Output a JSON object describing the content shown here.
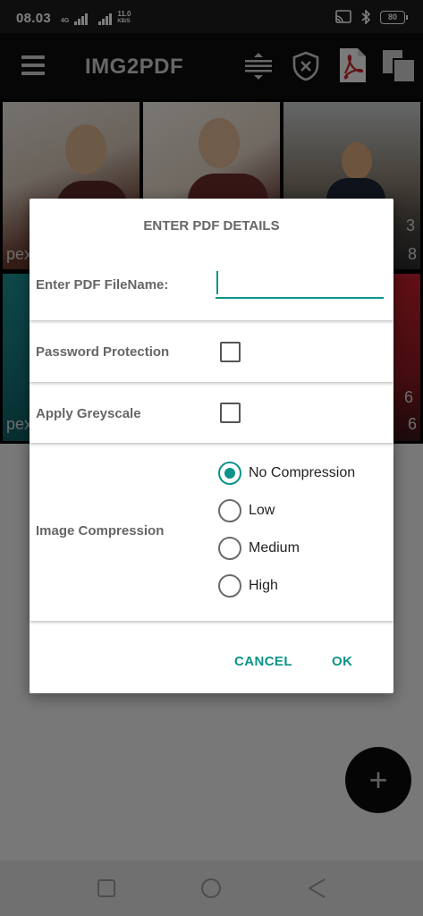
{
  "status_bar": {
    "time": "08.03",
    "network_type": "4G",
    "net_speed_value": "11.0",
    "net_speed_unit": "KB/S",
    "battery": "80"
  },
  "toolbar": {
    "title": "IMG2PDF"
  },
  "grid": {
    "tiles": [
      {
        "label": "pex"
      },
      {
        "label": ""
      },
      {
        "label": "3",
        "label2": "8"
      },
      {
        "label": "pex"
      },
      {
        "label": ""
      },
      {
        "label": "6",
        "label2": "6"
      }
    ]
  },
  "dialog": {
    "title": "ENTER PDF DETAILS",
    "filename_label": "Enter PDF FileName:",
    "filename_value": "",
    "password_label": "Password Protection",
    "password_checked": false,
    "greyscale_label": "Apply Greyscale",
    "greyscale_checked": false,
    "compression_label": "Image Compression",
    "compression_options": [
      "No Compression",
      "Low",
      "Medium",
      "High"
    ],
    "compression_selected": "No Compression",
    "cancel_label": "CANCEL",
    "ok_label": "OK"
  },
  "colors": {
    "accent": "#0b9488",
    "toolbar": "#0d0d0d",
    "label_text": "#666666"
  },
  "icons": {
    "toolbar": [
      "menu-icon",
      "sort-icon",
      "shield-close-icon",
      "pdf-file-icon",
      "copy-icon"
    ],
    "fab": "plus-icon",
    "nav": [
      "recents-square-icon",
      "home-circle-icon",
      "back-triangle-icon"
    ]
  }
}
